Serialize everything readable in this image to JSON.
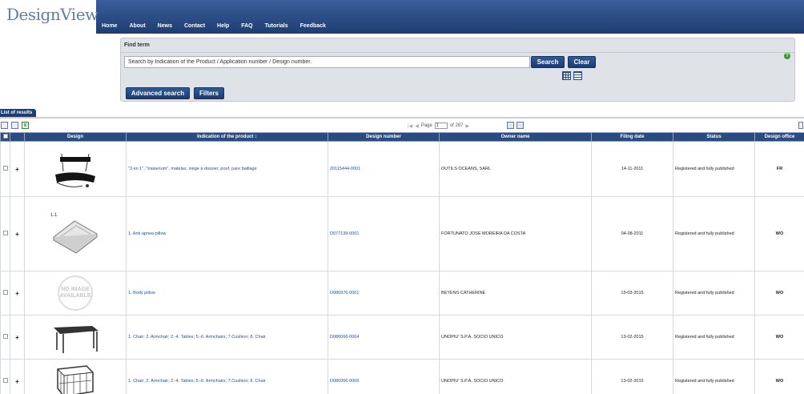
{
  "header": {
    "logo": "DesignView",
    "nav": [
      "Home",
      "About",
      "News",
      "Contact",
      "Help",
      "FAQ",
      "Tutorials",
      "Feedback"
    ]
  },
  "find": {
    "title": "Find term",
    "input_value": "Search by Indication of the Product / Application number / Design number.",
    "search_label": "Search",
    "clear_label": "Clear",
    "advanced_label": "Advanced search",
    "filters_label": "Filters",
    "help_icon": "?"
  },
  "results": {
    "tab_label": "List of results",
    "pager": {
      "page_label": "Page",
      "page_value": "1",
      "of_label": "of 267"
    }
  },
  "table": {
    "headers": [
      "",
      "",
      "Design",
      "Indication of the product ↕",
      "Design number",
      "Owner name",
      "Filing date",
      "Status",
      "Design office"
    ],
    "rows": [
      {
        "image": "hammock-chair",
        "indication": "\"3 en 1\", \"traisenum\", matelas, siège à dossier, pouf, pare baillage",
        "number": "20115444-0001",
        "owner": "OUTILS OCEANS, SARL",
        "date": "14-11-2011",
        "status": "Registered and fully published",
        "office": "FR"
      },
      {
        "image": "pillow",
        "image_label": "1.1",
        "indication": "1. Anti apnea pillow",
        "number": "D077139-0001",
        "owner": "FORTUNATO JOSE MOREIRA DA COSTA",
        "date": "04-08-2011",
        "status": "Registered and fully published",
        "office": "WO"
      },
      {
        "image": "no-image",
        "no_image_text": "NO IMAGE AVAILABLE",
        "indication": "1. Body pillow",
        "number": "D086976-0001",
        "owner": "BEYENS CATHERINE",
        "date": "15-03-2015",
        "status": "Registered and fully published",
        "office": "WO"
      },
      {
        "image": "table",
        "indication": "1. Chair; 2. Armchair; 2.-4. Tables; 5.-6. Armchairs; 7.Cushion; 8. Chair",
        "number": "D086066-0004",
        "owner": "UNOPIU' S.P.A. SOCIO UNICO",
        "date": "13-02-2015",
        "status": "Registered and fully published",
        "office": "WO"
      },
      {
        "image": "armchair",
        "indication": "1. Chair; 2. Armchair; 2.-4. Tables; 5.-6. Armchairs; 7.Cushion; 8. Chair",
        "number": "D086066-0006",
        "owner": "UNOPIU' S.P.A. SOCIO UNICO",
        "date": "13-02-2015",
        "status": "Registered and fully published",
        "office": "WO"
      }
    ]
  },
  "colors": {
    "header": "#1f3d72",
    "button": "#2f5b9a",
    "link": "#1f4f9f"
  }
}
